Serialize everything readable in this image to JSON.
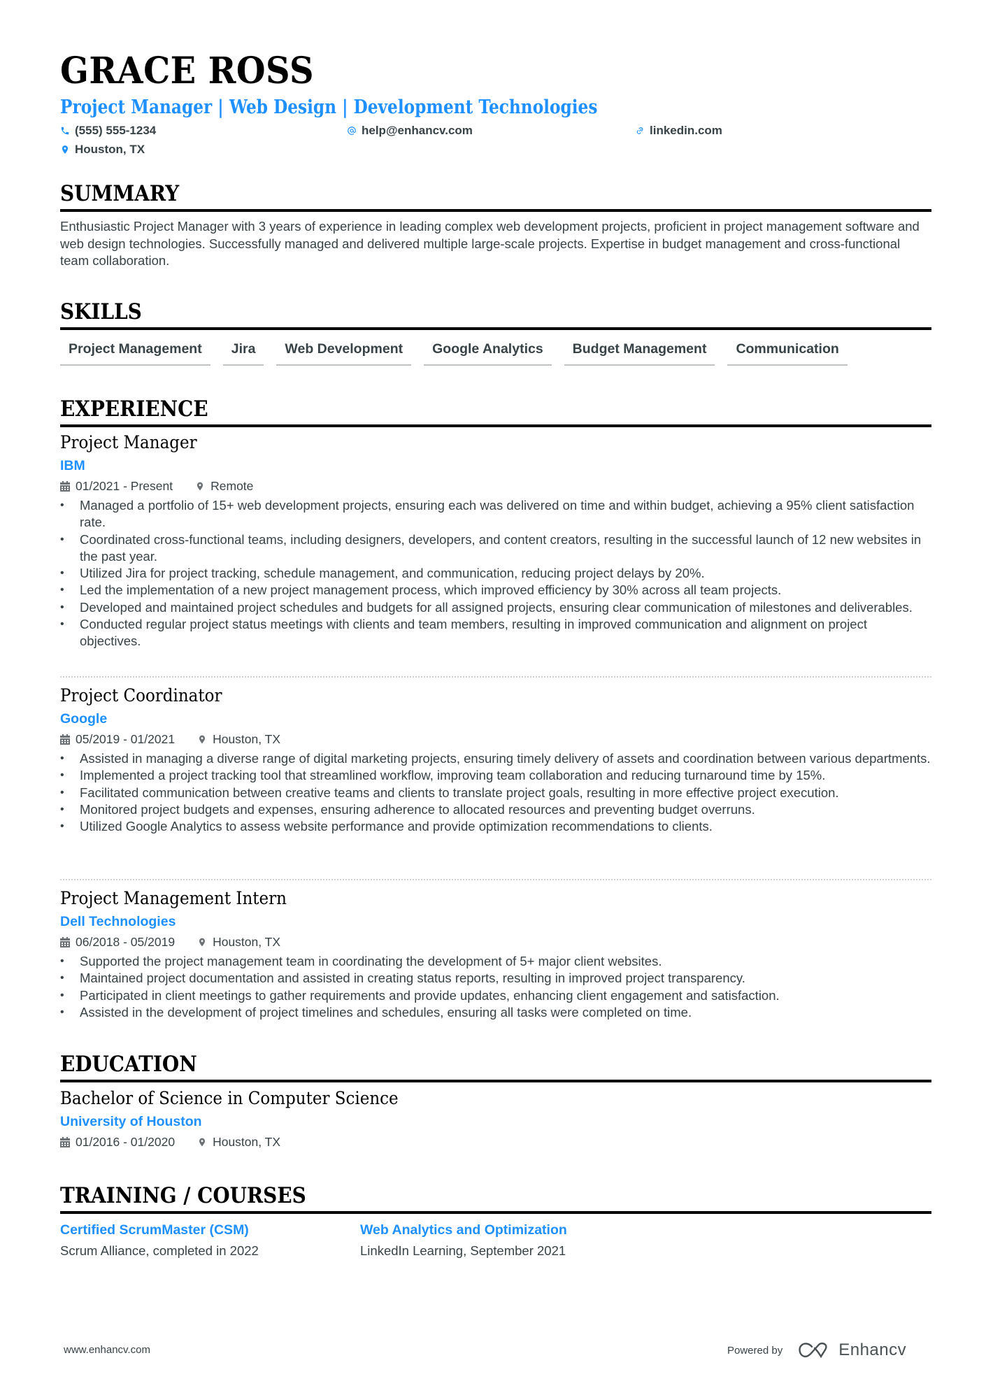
{
  "header": {
    "name": "GRACE ROSS",
    "headline": "Project Manager | Web Design | Development Technologies",
    "phone": "(555) 555-1234",
    "email": "help@enhancv.com",
    "link": "linkedin.com",
    "location": "Houston, TX",
    "icons": [
      "phone-icon",
      "at-icon",
      "link-icon",
      "map-pin-icon"
    ]
  },
  "colors": {
    "accent": "#1e90ff",
    "text": "#384347",
    "heading": "#000000"
  },
  "summary": {
    "title": "SUMMARY",
    "text": "Enthusiastic Project Manager with 3 years of experience in leading complex web development projects, proficient in project management software and web design technologies. Successfully managed and delivered multiple large-scale projects. Expertise in budget management and cross-functional team collaboration."
  },
  "skills": {
    "title": "SKILLS",
    "items": [
      "Project Management",
      "Jira",
      "Web Development",
      "Google Analytics",
      "Budget Management",
      "Communication"
    ]
  },
  "experience": {
    "title": "EXPERIENCE",
    "jobs": [
      {
        "title": "Project Manager",
        "company": "IBM",
        "dates": "01/2021 - Present",
        "location": "Remote",
        "bullets": [
          "Managed a portfolio of 15+ web development projects, ensuring each was delivered on time and within budget, achieving a 95% client satisfaction rate.",
          "Coordinated cross-functional teams, including designers, developers, and content creators, resulting in the successful launch of 12 new websites in the past year.",
          "Utilized Jira for project tracking, schedule management, and communication, reducing project delays by 20%.",
          "Led the implementation of a new project management process, which improved efficiency by 30% across all team projects.",
          "Developed and maintained project schedules and budgets for all assigned projects, ensuring clear communication of milestones and deliverables.",
          "Conducted regular project status meetings with clients and team members, resulting in improved communication and alignment on project objectives."
        ]
      },
      {
        "title": "Project Coordinator",
        "company": "Google",
        "dates": "05/2019 - 01/2021",
        "location": "Houston, TX",
        "bullets": [
          "Assisted in managing a diverse range of digital marketing projects, ensuring timely delivery of assets and coordination between various departments.",
          "Implemented a project tracking tool that streamlined workflow, improving team collaboration and reducing turnaround time by 15%.",
          "Facilitated communication between creative teams and clients to translate project goals, resulting in more effective project execution.",
          "Monitored project budgets and expenses, ensuring adherence to allocated resources and preventing budget overruns.",
          "Utilized Google Analytics to assess website performance and provide optimization recommendations to clients."
        ]
      },
      {
        "title": "Project Management Intern",
        "company": "Dell Technologies",
        "dates": "06/2018 - 05/2019",
        "location": "Houston, TX",
        "bullets": [
          "Supported the project management team in coordinating the development of 5+ major client websites.",
          "Maintained project documentation and assisted in creating status reports, resulting in improved project transparency.",
          "Participated in client meetings to gather requirements and provide updates, enhancing client engagement and satisfaction.",
          "Assisted in the development of project timelines and schedules, ensuring all tasks were completed on time."
        ]
      }
    ]
  },
  "education": {
    "title": "EDUCATION",
    "degree": "Bachelor of Science in Computer Science",
    "school": "University of Houston",
    "dates": "01/2016 - 01/2020",
    "location": "Houston, TX"
  },
  "training": {
    "title": "TRAINING / COURSES",
    "courses": [
      {
        "title": "Certified ScrumMaster (CSM)",
        "desc": "Scrum Alliance, completed in 2022"
      },
      {
        "title": "Web Analytics and Optimization",
        "desc": "LinkedIn Learning, September 2021"
      }
    ]
  },
  "footer": {
    "url": "www.enhancv.com",
    "powered_by": "Powered by",
    "brand": "Enhancv"
  }
}
